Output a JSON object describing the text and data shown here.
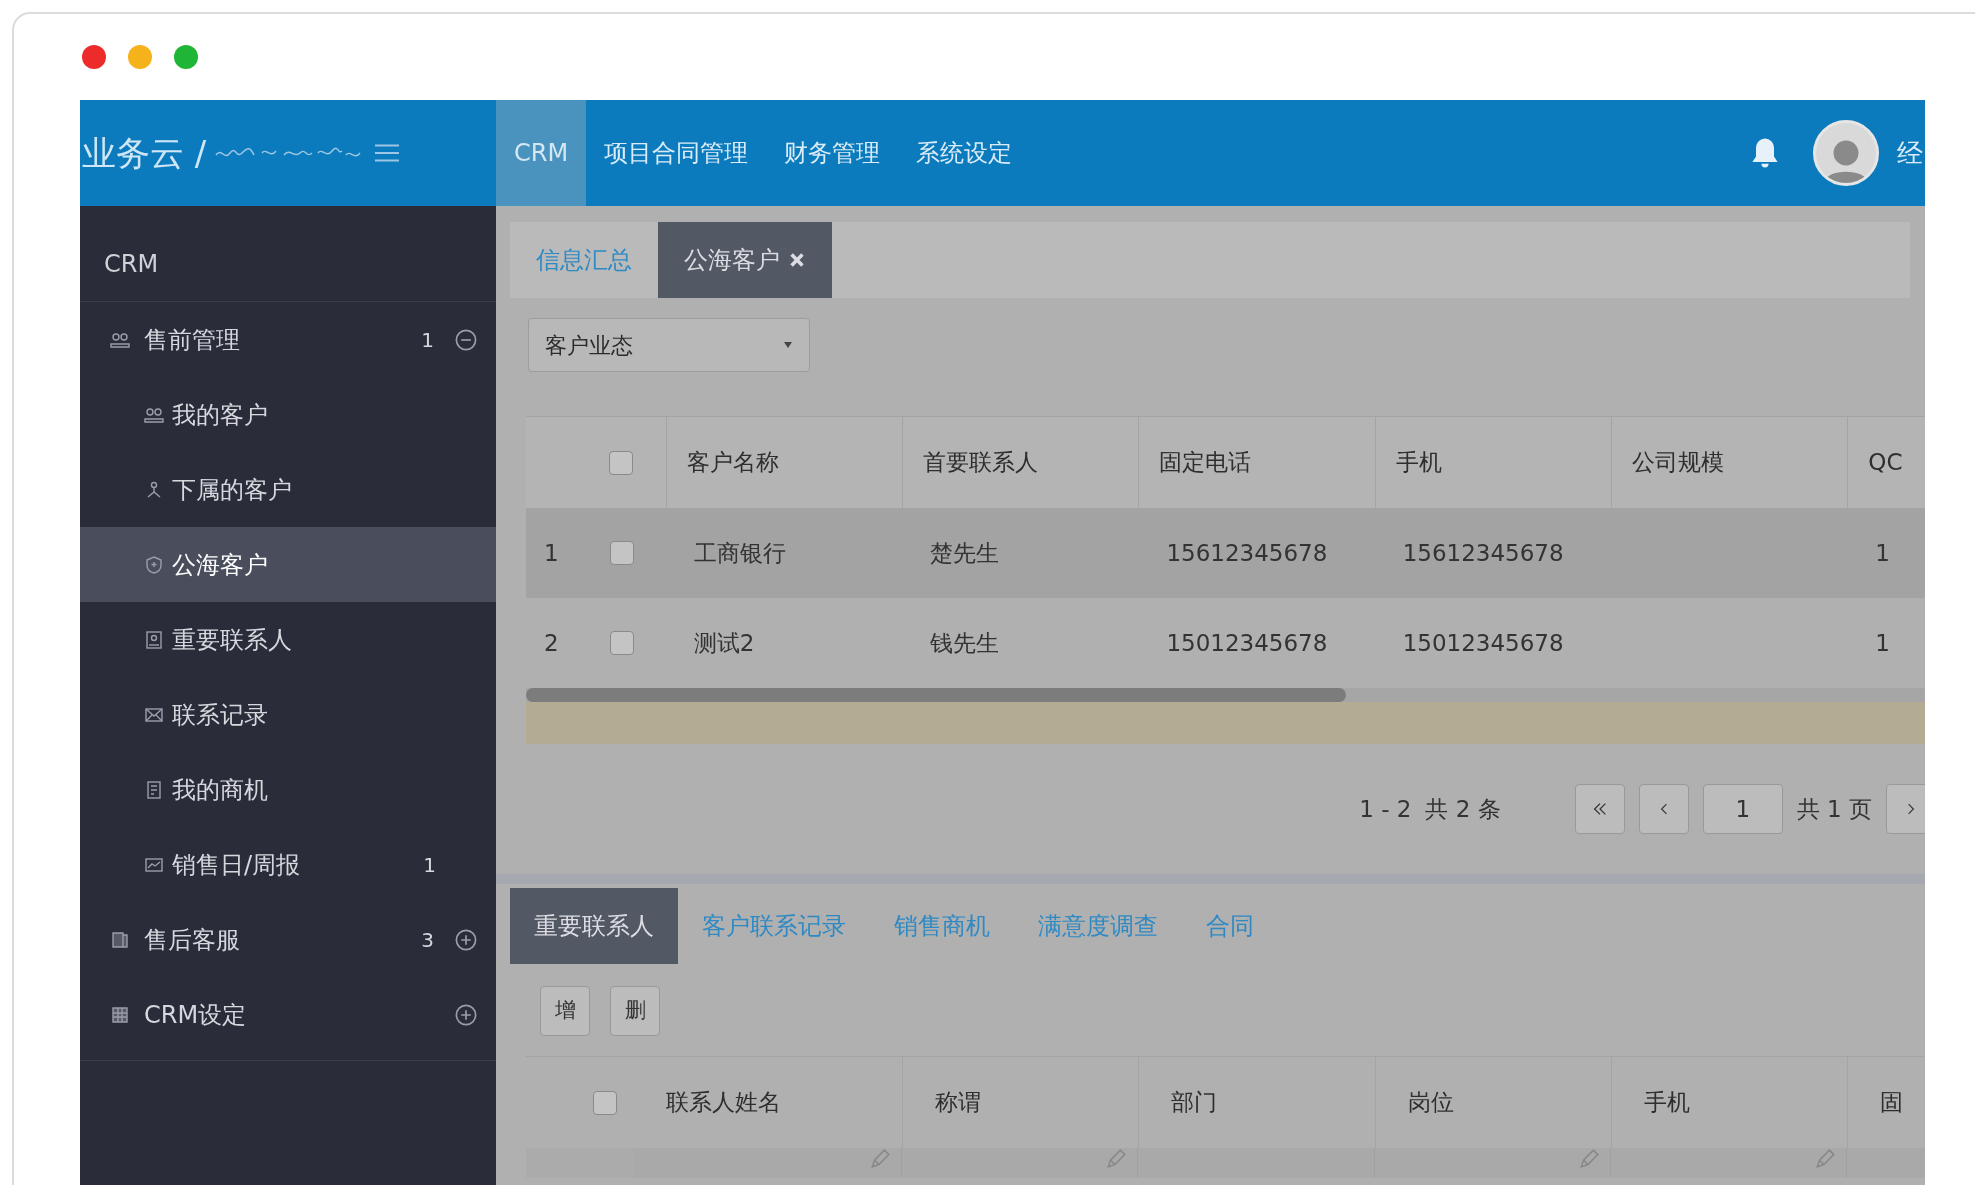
{
  "header": {
    "logo": "业务云 /",
    "menu": [
      {
        "label": "CRM",
        "selected": true
      },
      {
        "label": "项目合同管理",
        "selected": false
      },
      {
        "label": "财务管理",
        "selected": false
      },
      {
        "label": "系统设定",
        "selected": false
      }
    ],
    "user": "经"
  },
  "sidebar": {
    "title": "CRM",
    "items": [
      {
        "label": "售前管理",
        "badge": "1",
        "expanded": true,
        "selected": false,
        "children": [
          {
            "label": "我的客户",
            "selected": false
          },
          {
            "label": "下属的客户",
            "selected": false
          },
          {
            "label": "公海客户",
            "selected": true
          },
          {
            "label": "重要联系人",
            "selected": false
          },
          {
            "label": "联系记录",
            "selected": false
          },
          {
            "label": "我的商机",
            "selected": false
          },
          {
            "label": "销售日/周报",
            "badge": "1",
            "selected": false
          }
        ]
      },
      {
        "label": "售后客服",
        "badge": "3",
        "expanded": false,
        "selected": false
      },
      {
        "label": "CRM设定",
        "expanded": false,
        "selected": false
      }
    ]
  },
  "page_tabs": [
    {
      "label": "信息汇总",
      "selected": false
    },
    {
      "label": "公海客户",
      "selected": true
    }
  ],
  "filter": {
    "value": "客户业态"
  },
  "customers": {
    "checked": false,
    "columns": [
      "客户名称",
      "首要联系人",
      "固定电话",
      "手机",
      "公司规模",
      "QC"
    ],
    "rows": [
      {
        "index": "1",
        "selected": true,
        "checked": false,
        "cells": [
          "工商银行",
          "楚先生",
          "15612345678",
          "15612345678",
          null,
          "1"
        ]
      },
      {
        "index": "2",
        "selected": false,
        "checked": false,
        "cells": [
          "测试2",
          "钱先生",
          "15012345678",
          "15012345678",
          null,
          "1"
        ]
      }
    ]
  },
  "pagination": {
    "range": "1 - 2",
    "total": "共 2 条",
    "page": "1",
    "pages": "共 1 页"
  },
  "detail_tabs": [
    {
      "label": "重要联系人",
      "selected": true
    },
    {
      "label": "客户联系记录",
      "selected": false
    },
    {
      "label": "销售商机",
      "selected": false
    },
    {
      "label": "满意度调查",
      "selected": false
    },
    {
      "label": "合同",
      "selected": false
    }
  ],
  "toolbar": [
    "增",
    "删"
  ],
  "contacts": {
    "checked": false,
    "columns": [
      {
        "label": "联系人姓名",
        "editable": true
      },
      {
        "label": "称谓",
        "editable": true
      },
      {
        "label": "部门",
        "editable": false
      },
      {
        "label": "岗位",
        "editable": true
      },
      {
        "label": "手机",
        "editable": true
      },
      {
        "label": "固"
      }
    ]
  }
}
